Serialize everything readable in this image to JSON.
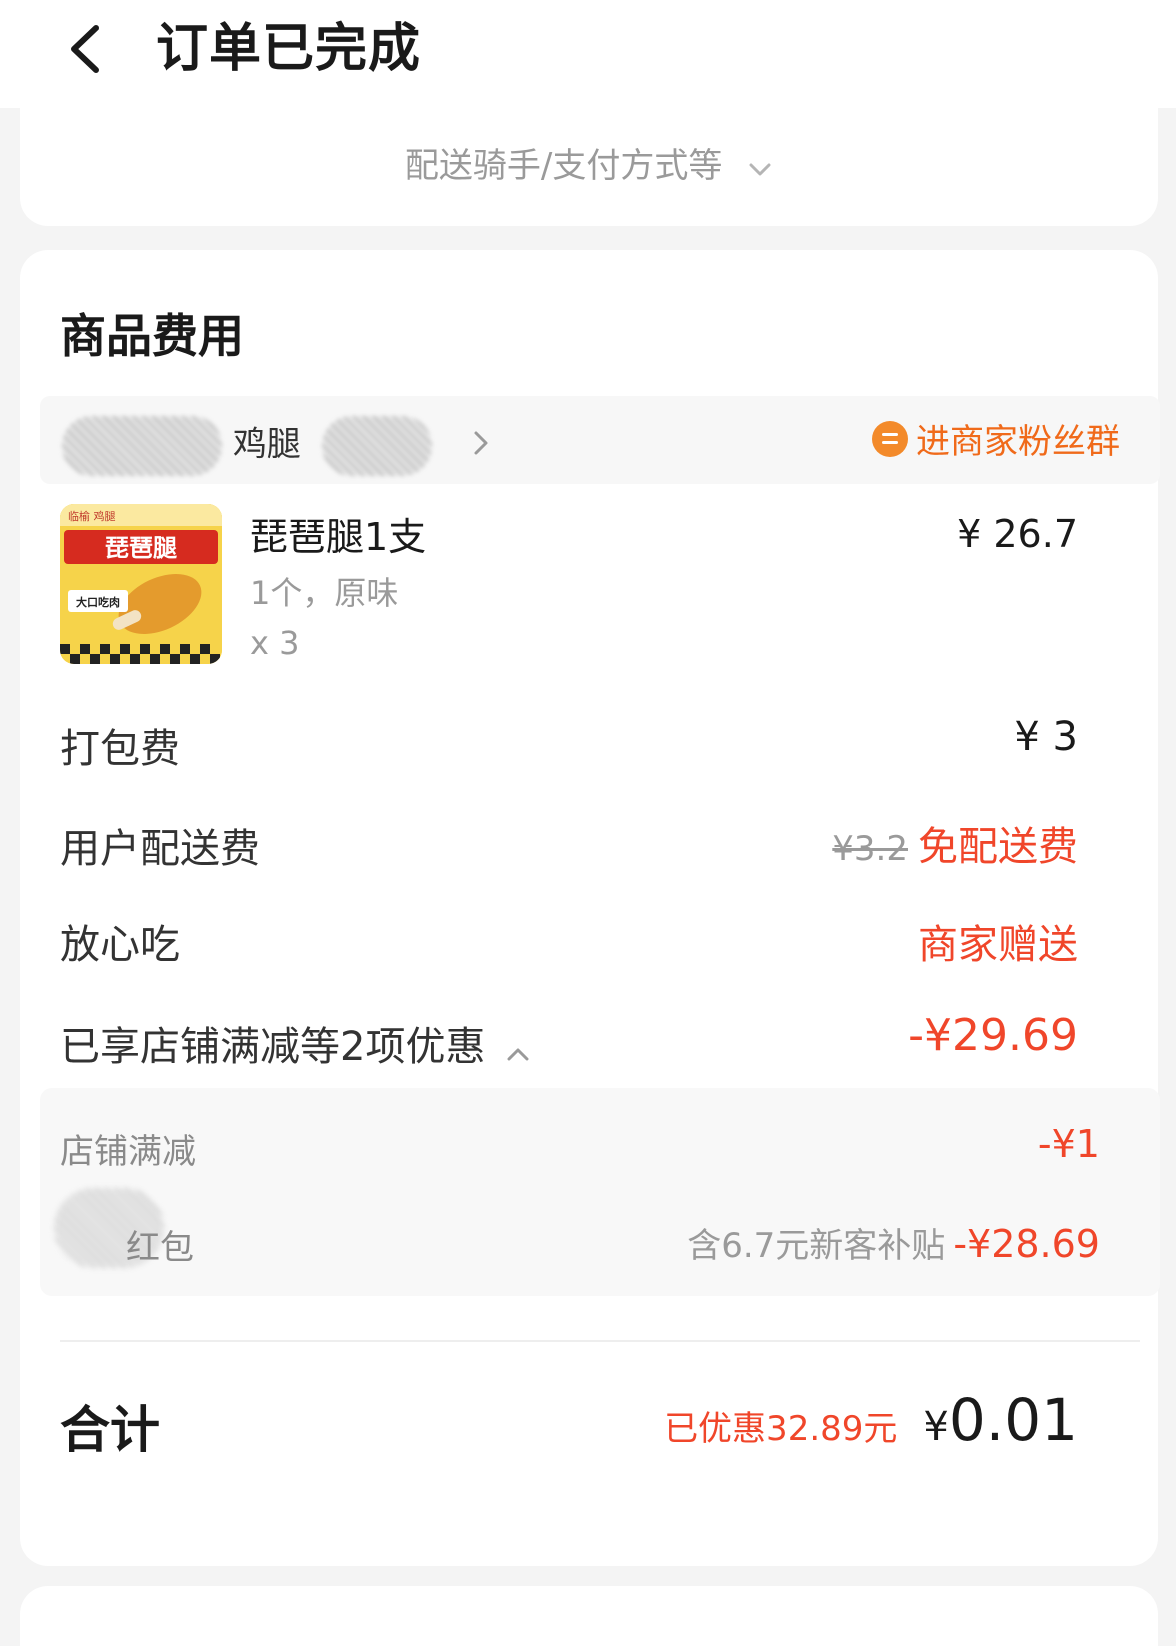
{
  "header": {
    "title": "订单已完成"
  },
  "top_card": {
    "expand_label": "配送骑手/支付方式等"
  },
  "fees": {
    "section_title": "商品费用",
    "store": {
      "name_visible": "鸡腿",
      "fan_group_label": "进商家粉丝群"
    },
    "product": {
      "name": "琵琶腿1支",
      "spec": "1个，原味",
      "qty": "x 3",
      "price": "¥ 26.7",
      "thumb_texts": {
        "brand": "临榆 鸡腿",
        "headline": "琵琶腿",
        "badge": "大口吃肉"
      }
    },
    "rows": {
      "packing_label": "打包费",
      "packing_value": "¥ 3",
      "delivery_label": "用户配送费",
      "delivery_original": "¥3.2",
      "delivery_value": "免配送费",
      "assure_label": "放心吃",
      "assure_value": "商家赠送",
      "discount_label": "已享店铺满减等2项优惠",
      "discount_value": "-¥29.69"
    },
    "discount_details": [
      {
        "label": "店铺满减",
        "note": "",
        "value": "-¥1"
      },
      {
        "label": "红包",
        "note": "含6.7元新客补贴",
        "value": "-¥28.69"
      }
    ],
    "total": {
      "label": "合计",
      "saved": "已优惠32.89元",
      "yen": "¥",
      "value": "0.01"
    }
  },
  "colors": {
    "accent_red": "#f0462a",
    "accent_orange": "#f06a1a",
    "muted_text": "#9a9a9a",
    "background": "#f4f4f4"
  },
  "icons": [
    "back-arrow-icon",
    "chevron-down-icon",
    "chevron-right-icon",
    "fan-group-icon",
    "chevron-up-icon"
  ]
}
